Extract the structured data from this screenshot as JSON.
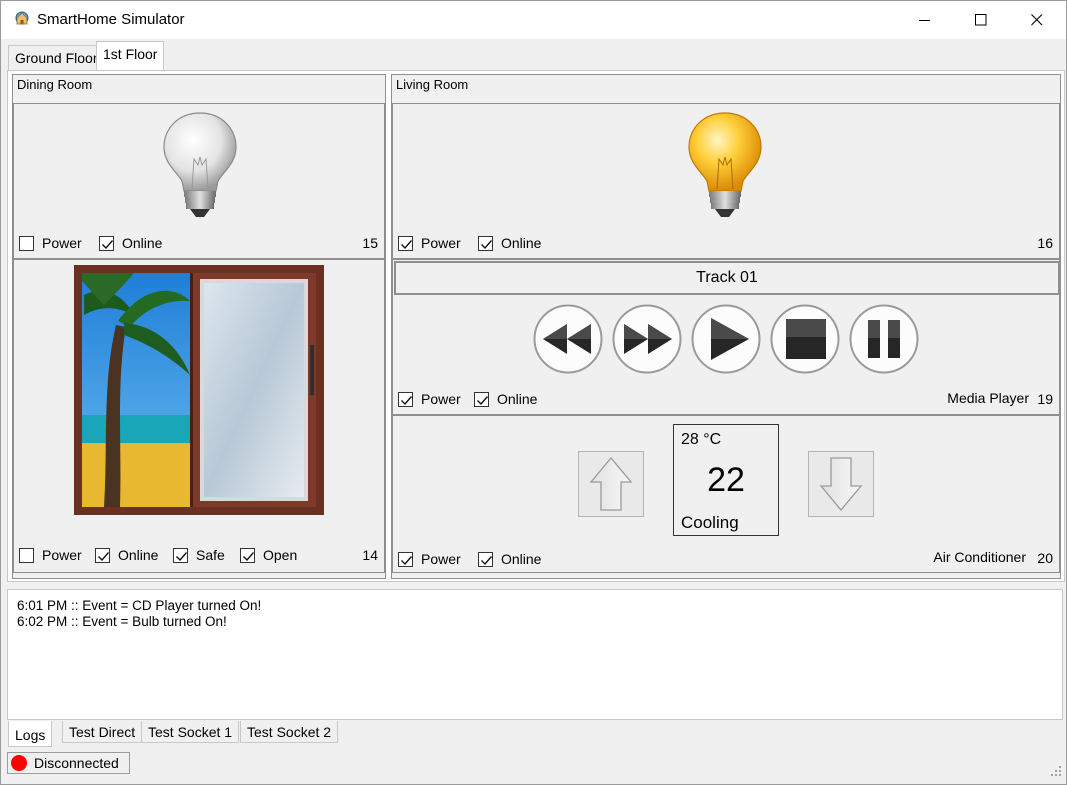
{
  "window": {
    "title": "SmartHome Simulator"
  },
  "floor_tabs": [
    {
      "label": "Ground Floor",
      "active": false
    },
    {
      "label": "1st Floor",
      "active": true
    }
  ],
  "rooms": {
    "dining": {
      "title": "Dining Room",
      "bulb": {
        "power": false,
        "online": true,
        "id": "15",
        "lit": false,
        "power_label": "Power",
        "online_label": "Online"
      },
      "window": {
        "power": false,
        "online": true,
        "safe": true,
        "open": true,
        "id": "14",
        "power_label": "Power",
        "online_label": "Online",
        "safe_label": "Safe",
        "open_label": "Open"
      }
    },
    "living": {
      "title": "Living Room",
      "bulb": {
        "power": true,
        "online": true,
        "id": "16",
        "lit": true,
        "power_label": "Power",
        "online_label": "Online"
      },
      "media": {
        "track": "Track 01",
        "power": true,
        "online": true,
        "type": "Media Player",
        "id": "19",
        "power_label": "Power",
        "online_label": "Online",
        "buttons": [
          "rewind-icon",
          "fast-forward-icon",
          "play-icon",
          "stop-icon",
          "pause-icon"
        ]
      },
      "ac": {
        "current_temp": "28 °C",
        "setpoint": "22",
        "mode": "Cooling",
        "power": true,
        "online": true,
        "type": "Air Conditioner",
        "id": "20",
        "power_label": "Power",
        "online_label": "Online"
      }
    }
  },
  "logs": [
    "6:01 PM :: Event = CD Player turned On!",
    "6:02 PM :: Event = Bulb turned On!"
  ],
  "bottom_tabs": [
    {
      "label": "Logs",
      "active": true
    },
    {
      "label": "Test Direct",
      "active": false
    },
    {
      "label": "Test Socket 1",
      "active": false
    },
    {
      "label": "Test Socket 2",
      "active": false
    }
  ],
  "status": {
    "label": "Disconnected",
    "color": "#ff0000"
  }
}
